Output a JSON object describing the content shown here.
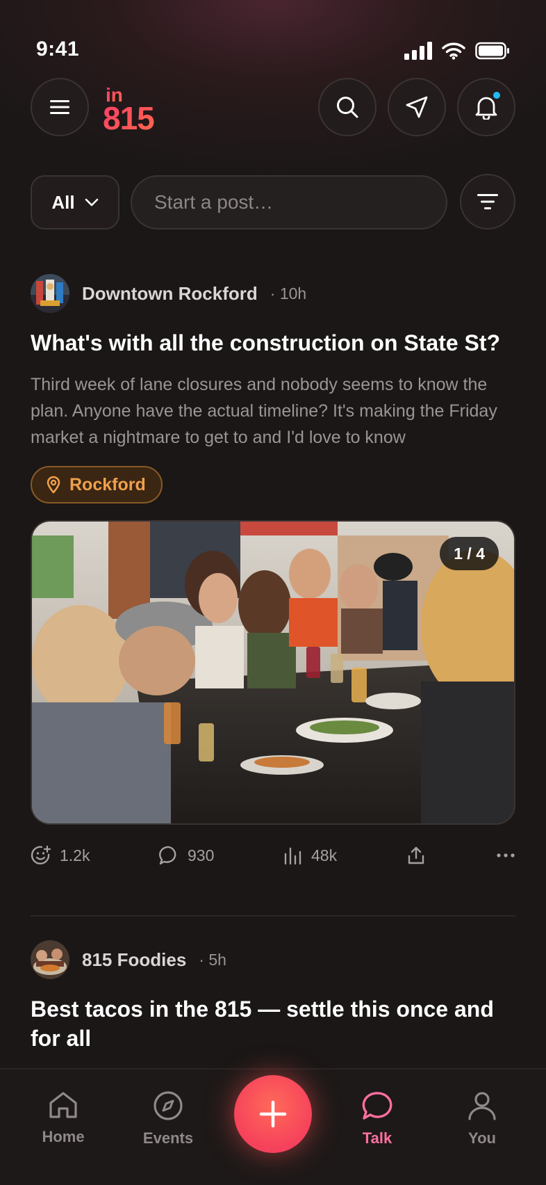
{
  "status_bar": {
    "time": "9:41"
  },
  "header": {
    "logo_top": "in",
    "logo_bottom": "815",
    "colors": {
      "brand": "#f2505f",
      "notification_dot": "#22b8f0"
    }
  },
  "composer": {
    "filter_label": "All",
    "post_placeholder": "Start a post…"
  },
  "posts": [
    {
      "author": "Downtown Rockford",
      "time": "· 10h",
      "title": "What's with all the construction on State St?",
      "body": "Third week of lane closures and nobody seems to know the plan. Anyone have the actual timeline? It's making the Friday market a nightmare to get to and I'd love to know",
      "location": "Rockford",
      "image_counter": "1 / 4",
      "reactions": "1.2k",
      "comments": "930",
      "views": "48k"
    },
    {
      "author": "815 Foodies",
      "time": "· 5h",
      "title": "Best tacos in the 815 — settle this once and for all"
    }
  ],
  "bottom_nav": {
    "items": [
      {
        "label": "Home",
        "icon": "home-icon"
      },
      {
        "label": "Events",
        "icon": "compass-icon"
      },
      {
        "label": "Talk",
        "icon": "chat-bubble-icon"
      },
      {
        "label": "You",
        "icon": "person-icon"
      }
    ],
    "active": "Talk",
    "colors": {
      "active": "#ff6fa0",
      "fab": "#f5415b"
    }
  }
}
